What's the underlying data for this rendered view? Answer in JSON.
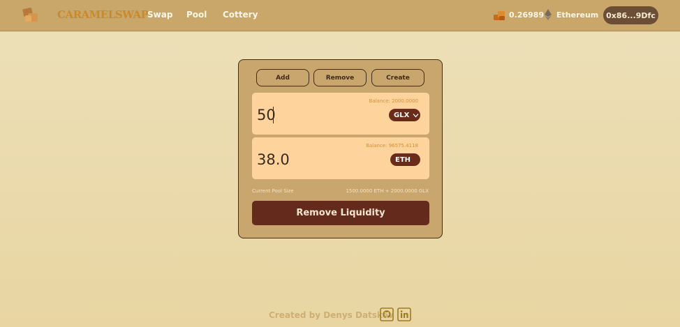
{
  "header": {
    "brand": "CARAMELSWAP",
    "nav": [
      "Swap",
      "Pool",
      "Cottery"
    ],
    "caramel_balance": "0.26989",
    "network": "Ethereum",
    "wallet": "0x86...9Dfc"
  },
  "tabs": [
    "Add",
    "Remove",
    "Create"
  ],
  "token_a": {
    "balance": "Balance: 2000.0000",
    "amount": "50",
    "symbol": "GLX"
  },
  "token_b": {
    "balance": "Balance: 96575.4118",
    "amount": "38.0",
    "symbol": "ETH"
  },
  "pool": {
    "label": "Current Pool Size",
    "value": "1500.0000 ETH + 2000.0000 GLX"
  },
  "submit_label": "Remove Liquidity",
  "footer": {
    "credit": "Created by Denys Datskov",
    "icons": [
      "github-icon",
      "linkedin-icon"
    ]
  },
  "colors": {
    "header_bg": "#c9a669",
    "page_bg": "#ede0b9",
    "card_bg": "#c8a66d",
    "input_bg": "#ffd49c",
    "button_bg": "#642b1c",
    "token_pill_bg": "#6b2b1b",
    "wallet_bg": "#6b4e35",
    "brand": "#c98a2c"
  }
}
